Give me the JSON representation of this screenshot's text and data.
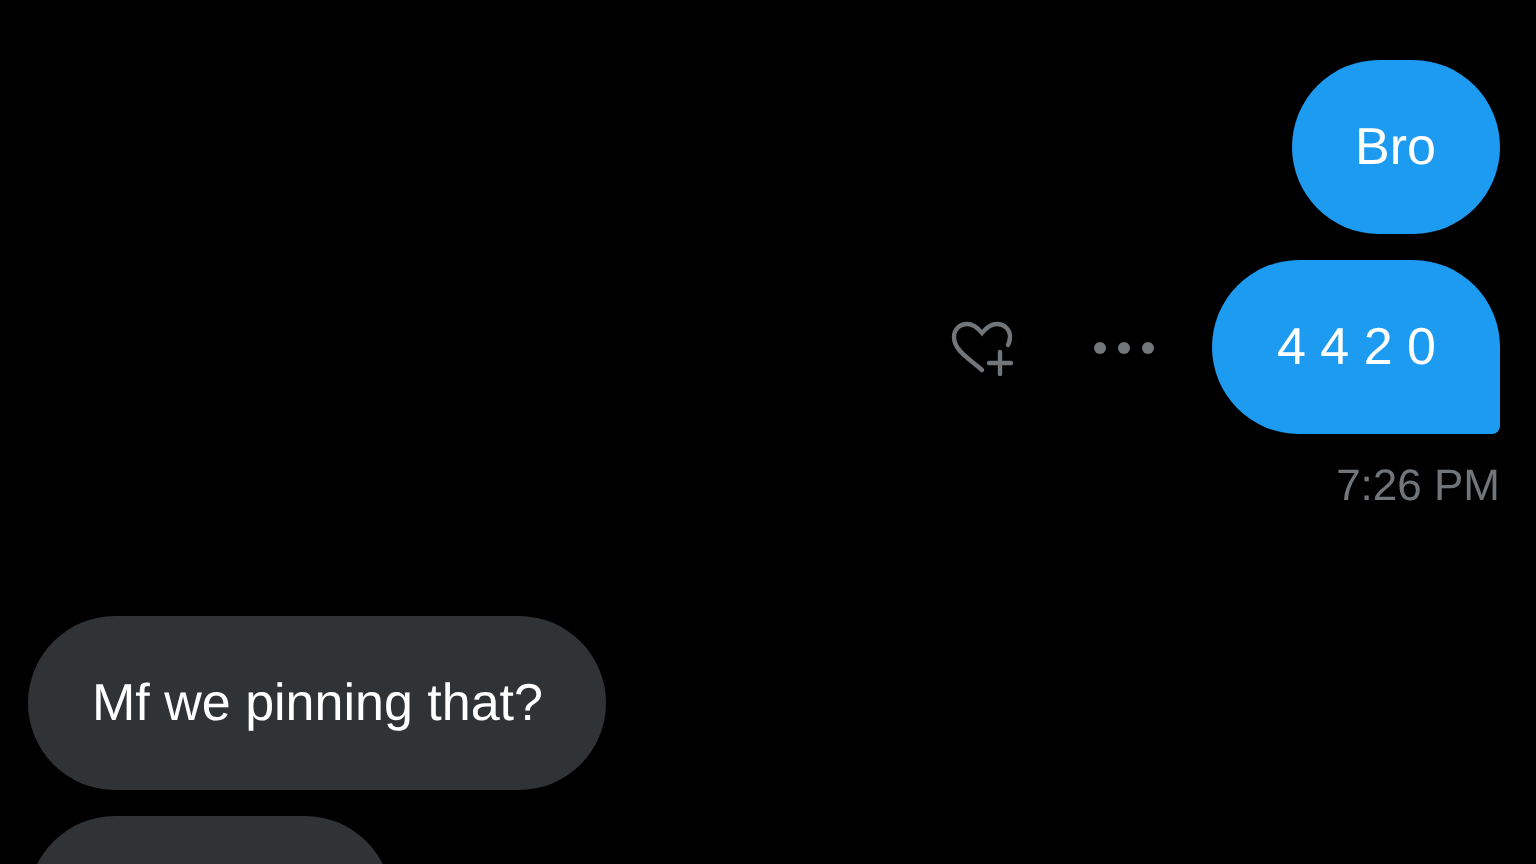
{
  "messages": [
    {
      "kind": "sent",
      "text": "Bro",
      "tail": false,
      "actions": false
    },
    {
      "kind": "sent",
      "text": "4 4 2 0",
      "tail": true,
      "actions": true,
      "time": "7:26 PM"
    },
    {
      "kind": "received",
      "text": "Mf we pinning that?",
      "tail": false,
      "actions": false
    },
    {
      "kind": "received"
    }
  ]
}
